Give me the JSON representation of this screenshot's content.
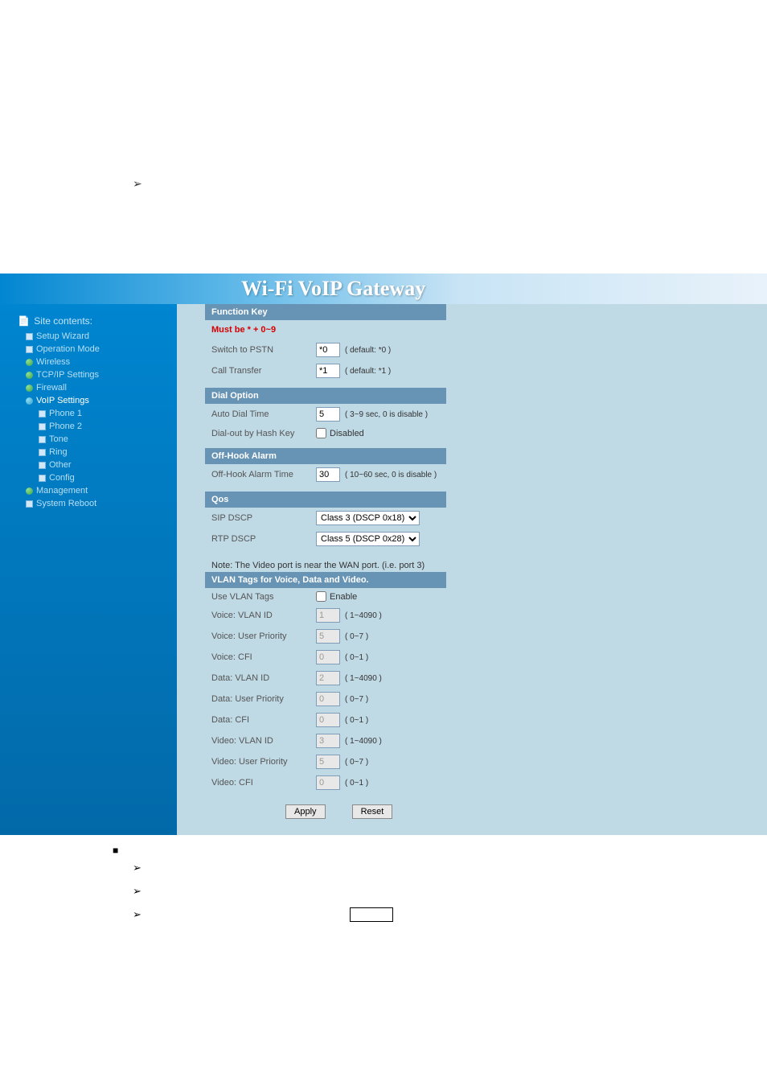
{
  "header": {
    "title": "Wi-Fi  VoIP   Gateway"
  },
  "sidebar": {
    "title": "Site contents:",
    "items": [
      {
        "label": "Setup Wizard",
        "type": "file",
        "level": 1
      },
      {
        "label": "Operation Mode",
        "type": "file",
        "level": 1
      },
      {
        "label": "Wireless",
        "type": "green",
        "level": 1
      },
      {
        "label": "TCP/IP Settings",
        "type": "green",
        "level": 1
      },
      {
        "label": "Firewall",
        "type": "green",
        "level": 1
      },
      {
        "label": "VoIP Settings",
        "type": "cyan",
        "level": 1
      },
      {
        "label": "Phone 1",
        "type": "file",
        "level": 2
      },
      {
        "label": "Phone 2",
        "type": "file",
        "level": 2
      },
      {
        "label": "Tone",
        "type": "file",
        "level": 2
      },
      {
        "label": "Ring",
        "type": "file",
        "level": 2
      },
      {
        "label": "Other",
        "type": "file",
        "level": 2
      },
      {
        "label": "Config",
        "type": "file",
        "level": 2
      },
      {
        "label": "Management",
        "type": "green",
        "level": 1
      },
      {
        "label": "System Reboot",
        "type": "file",
        "level": 1
      }
    ]
  },
  "sections": {
    "function_key": {
      "header": "Function Key",
      "must_be": "Must be * + 0~9",
      "switch_to_pstn": {
        "label": "Switch to PSTN",
        "value": "*0",
        "hint": "( default: *0 )"
      },
      "call_transfer": {
        "label": "Call Transfer",
        "value": "*1",
        "hint": "( default: *1 )"
      }
    },
    "dial_option": {
      "header": "Dial Option",
      "auto_dial_time": {
        "label": "Auto Dial Time",
        "value": "5",
        "hint": "( 3~9 sec, 0 is disable )"
      },
      "dial_out_hash": {
        "label": "Dial-out by Hash Key",
        "checkbox_label": "Disabled"
      }
    },
    "off_hook": {
      "header": "Off-Hook Alarm",
      "off_hook_time": {
        "label": "Off-Hook Alarm Time",
        "value": "30",
        "hint": "( 10~60 sec, 0 is disable )"
      }
    },
    "qos": {
      "header": "Qos",
      "sip_dscp": {
        "label": "SIP DSCP",
        "value": "Class 3 (DSCP 0x18)"
      },
      "rtp_dscp": {
        "label": "RTP DSCP",
        "value": "Class 5 (DSCP 0x28)"
      }
    },
    "vlan": {
      "note": "Note: The Video port is near the WAN port. (i.e. port 3)",
      "header": "VLAN Tags for Voice, Data and Video.",
      "use_vlan": {
        "label": "Use VLAN Tags",
        "checkbox_label": "Enable"
      },
      "rows": [
        {
          "label": "Voice: VLAN ID",
          "value": "1",
          "hint": "( 1~4090 )"
        },
        {
          "label": "Voice: User Priority",
          "value": "5",
          "hint": "( 0~7 )"
        },
        {
          "label": "Voice: CFI",
          "value": "0",
          "hint": "( 0~1 )"
        },
        {
          "label": "Data: VLAN ID",
          "value": "2",
          "hint": "( 1~4090 )"
        },
        {
          "label": "Data: User Priority",
          "value": "0",
          "hint": "( 0~7 )"
        },
        {
          "label": "Data: CFI",
          "value": "0",
          "hint": "( 0~1 )"
        },
        {
          "label": "Video: VLAN ID",
          "value": "3",
          "hint": "( 1~4090 )"
        },
        {
          "label": "Video: User Priority",
          "value": "5",
          "hint": "( 0~7 )"
        },
        {
          "label": "Video: CFI",
          "value": "0",
          "hint": "( 0~1 )"
        }
      ]
    }
  },
  "buttons": {
    "apply": "Apply",
    "reset": "Reset"
  }
}
